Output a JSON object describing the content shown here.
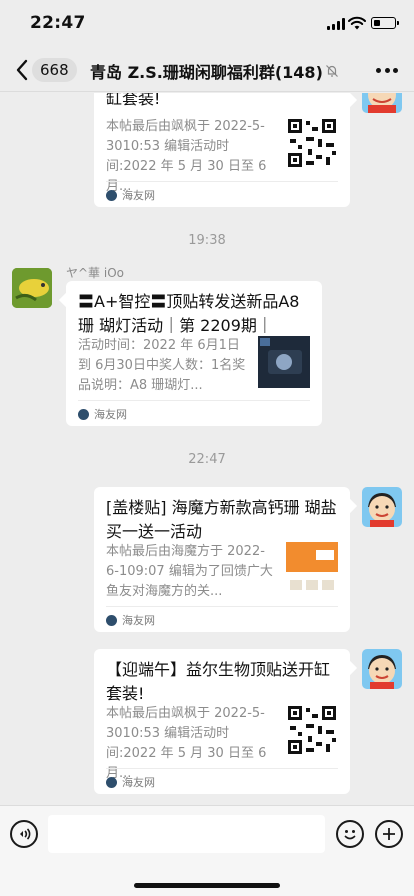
{
  "status_bar": {
    "time": "22:47"
  },
  "nav": {
    "back_count": "668",
    "title": "青岛 Z.S.珊瑚闲聊福利群(148)"
  },
  "messages": [
    {
      "title": "缸套装!",
      "desc": "本帖最后由飒枫于 2022-5-3010:53 编辑活动时间:2022 年 5 月 30 日至 6 月...",
      "source": "海友网"
    },
    {
      "timestamp": "19:38"
    },
    {
      "sender": "ヤ^華 iOo",
      "title": "〓A+智控〓顶贴转发送新品A8珊 瑚灯活动｜第 2209期｜",
      "desc": "活动时间：2022 年 6月1日到 6月30日中奖人数：1名奖品说明：A8 珊瑚灯...",
      "source": "海友网"
    },
    {
      "timestamp": "22:47"
    },
    {
      "title": "[盖楼贴] 海魔方新款高钙珊 瑚盐买一送一活动",
      "desc": "本帖最后由海魔方于 2022-6-109:07 编辑为了回馈广大鱼友对海魔方的关...",
      "source": "海友网"
    },
    {
      "title": "【迎端午】益尔生物顶贴送开缸套装!",
      "desc": "本帖最后由飒枫于 2022-5-3010:53 编辑活动时间:2022 年 5 月 30 日至 6 月...",
      "source": "海友网"
    }
  ],
  "input": {
    "placeholder": ""
  },
  "icons": {
    "back": "chevron-left-icon",
    "mute": "mute-bell-icon",
    "more": "more-dots-icon",
    "voice": "voice-icon",
    "emoji": "emoji-icon",
    "plus": "plus-icon"
  },
  "colors": {
    "background": "#ededed",
    "bubble": "#ffffff",
    "source_icon": "#2e4e6c"
  }
}
